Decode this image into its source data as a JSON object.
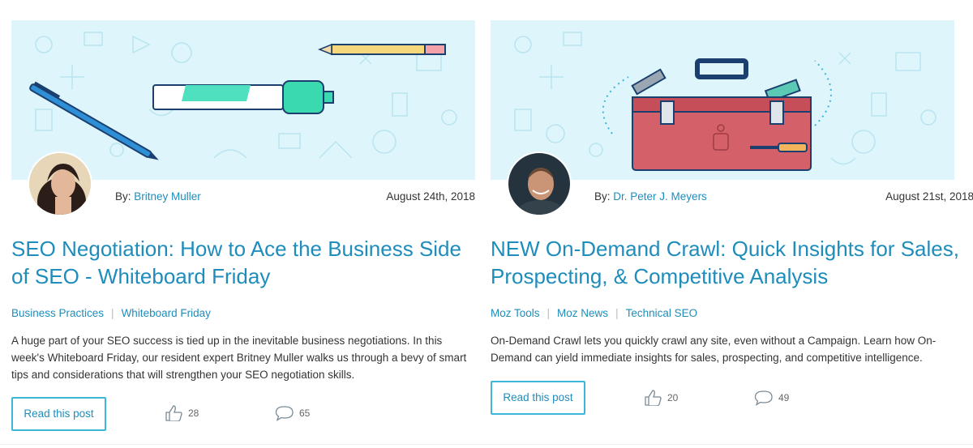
{
  "posts": [
    {
      "author_prefix": "By:",
      "author": "Britney Muller",
      "date": "August 24th, 2018",
      "title": "SEO Negotiation: How to Ace the Business Side of SEO - Whiteboard Friday",
      "tags": [
        "Business Practices",
        "Whiteboard Friday"
      ],
      "description": "A huge part of your SEO success is tied up in the inevitable business negotiations. In this week's Whiteboard Friday, our resident expert Britney Muller walks us through a bevy of smart tips and considerations that will strengthen your SEO negotiation skills.",
      "button_label": "Read this post",
      "likes": "28",
      "comments": "65"
    },
    {
      "author_prefix": "By:",
      "author": "Dr. Peter J. Meyers",
      "date": "August 21st, 2018",
      "title": "NEW On-Demand Crawl: Quick Insights for Sales, Prospecting, & Competitive Analysis",
      "tags": [
        "Moz Tools",
        "Moz News",
        "Technical SEO"
      ],
      "description": "On-Demand Crawl lets you quickly crawl any site, even without a Campaign. Learn how On-Demand can yield immediate insights for sales, prospecting, and competitive intelligence.",
      "button_label": "Read this post",
      "likes": "20",
      "comments": "49"
    }
  ],
  "colors": {
    "link": "#1f8dbb",
    "hero_bg": "#def5fb",
    "button_border": "#3fb6d8"
  },
  "icons": {
    "likes": "thumbs-up-icon",
    "comments": "speech-bubble-icon"
  }
}
